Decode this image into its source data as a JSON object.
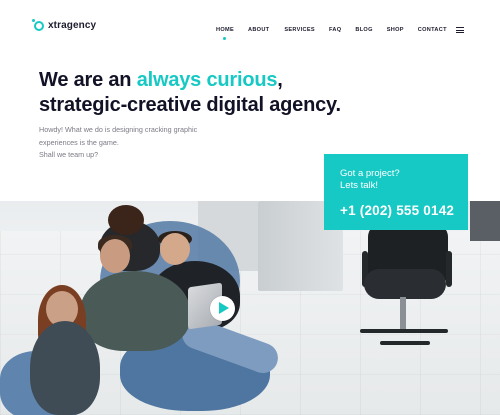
{
  "brand": {
    "name": "xtragency"
  },
  "nav": {
    "items": [
      {
        "label": "HOME",
        "active": true
      },
      {
        "label": "ABOUT",
        "active": false
      },
      {
        "label": "SERVICES",
        "active": false
      },
      {
        "label": "FAQ",
        "active": false
      },
      {
        "label": "BLOG",
        "active": false
      },
      {
        "label": "SHOP",
        "active": false
      },
      {
        "label": "CONTACT",
        "active": false
      }
    ]
  },
  "hero": {
    "title_prefix": "We are an ",
    "title_accent": "always curious",
    "title_suffix": ",",
    "title_line2": "strategic-creative digital agency.",
    "copy_lines": [
      "Howdy! What we do is designing cracking graphic",
      "experiences is the game.",
      "Shall we team up?"
    ]
  },
  "contact_card": {
    "line1": "Got a project?",
    "line2": "Lets talk!",
    "phone": "+1 (202) 555 0142"
  },
  "colors": {
    "accent": "#17c9c4",
    "text_dark": "#121226",
    "text_muted": "#7b7b86"
  },
  "icons": {
    "logo": "ring-dot-logo-icon",
    "menu": "hamburger-menu-icon",
    "play": "play-icon"
  }
}
